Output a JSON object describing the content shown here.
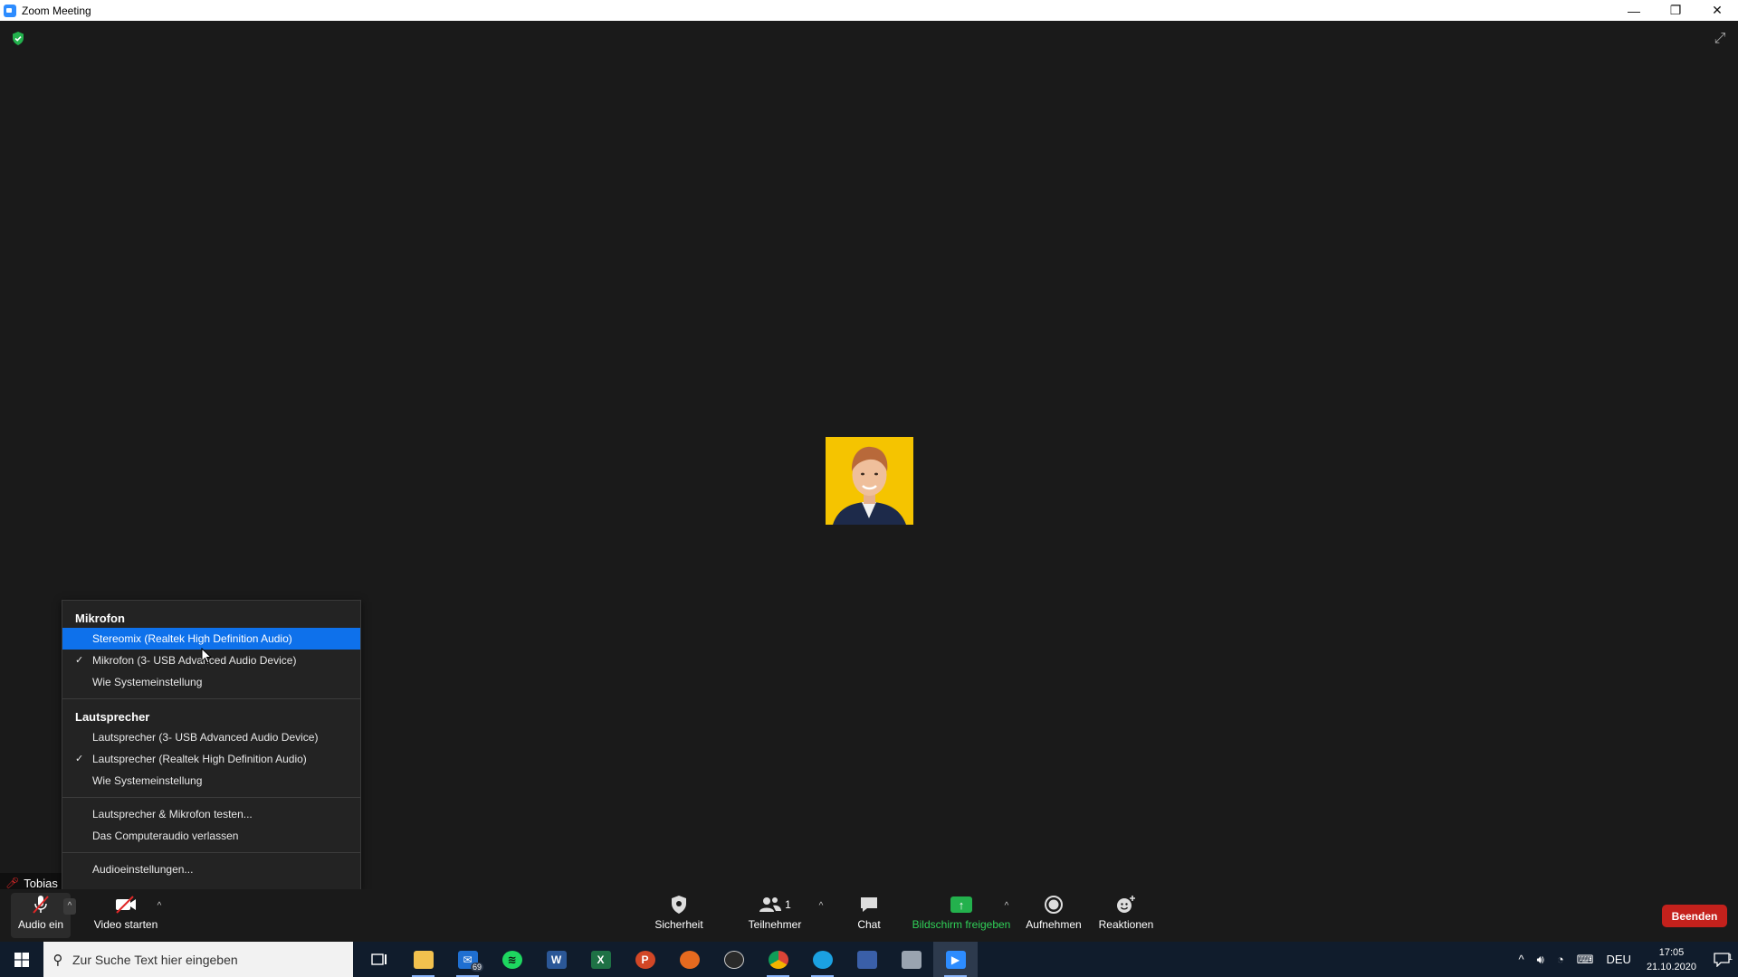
{
  "window": {
    "title": "Zoom Meeting",
    "controls": {
      "minimize": "—",
      "restore": "❐",
      "close": "✕"
    }
  },
  "meeting": {
    "participant_name": "Tobias E",
    "avatar_bg": "#f5c400"
  },
  "audio_menu": {
    "mic_header": "Mikrofon",
    "mic_items": [
      {
        "label": "Stereomix (Realtek High Definition Audio)",
        "checked": false,
        "selected": true
      },
      {
        "label": "Mikrofon (3- USB Advanced Audio Device)",
        "checked": true,
        "selected": false
      },
      {
        "label": "Wie Systemeinstellung",
        "checked": false,
        "selected": false
      }
    ],
    "speaker_header": "Lautsprecher",
    "speaker_items": [
      {
        "label": "Lautsprecher (3- USB Advanced Audio Device)",
        "checked": false
      },
      {
        "label": "Lautsprecher (Realtek High Definition Audio)",
        "checked": true
      },
      {
        "label": "Wie Systemeinstellung",
        "checked": false
      }
    ],
    "test_label": "Lautsprecher & Mikrofon testen...",
    "leave_audio_label": "Das Computeraudio verlassen",
    "settings_label": "Audioeinstellungen...",
    "check_mark": "✓"
  },
  "toolbar": {
    "audio_label": "Audio ein",
    "video_label": "Video starten",
    "security_label": "Sicherheit",
    "participants_label": "Teilnehmer",
    "participants_count": "1",
    "chat_label": "Chat",
    "share_label": "Bildschirm freigeben",
    "record_label": "Aufnehmen",
    "reactions_label": "Reaktionen",
    "end_label": "Beenden",
    "caret": "^",
    "share_color": "#30d158",
    "end_color": "#c4211c"
  },
  "taskbar": {
    "search_placeholder": "Zur Suche Text hier eingeben",
    "mail_badge": "69",
    "language": "DEU",
    "time": "17:05",
    "date": "21.10.2020",
    "notif_count": "1",
    "apps": [
      "task-view",
      "file-explorer",
      "mail",
      "spotify",
      "word",
      "excel",
      "powerpoint",
      "app-orange",
      "obs",
      "chrome",
      "edge",
      "app-blue",
      "app-grey",
      "zoom"
    ]
  }
}
